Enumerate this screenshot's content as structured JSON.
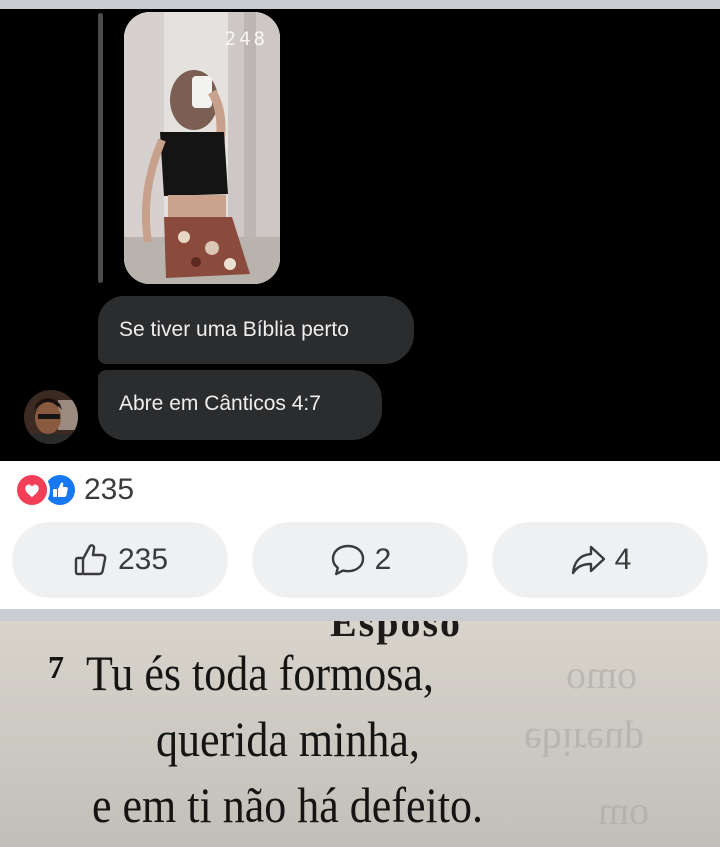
{
  "chat": {
    "story_view_count": "248",
    "messages": [
      "Se tiver uma Bíblia perto",
      "Abre em Cânticos 4:7"
    ]
  },
  "reactions": {
    "types": [
      "love-icon",
      "like-icon"
    ],
    "count": "235"
  },
  "actions": {
    "like_count": "235",
    "comment_count": "2",
    "share_count": "4"
  },
  "bible_page": {
    "heading_fragment": "Esposo",
    "verse_number": "7",
    "lines": [
      "Tu és toda formosa,",
      "querida minha,",
      "e em ti não há defeito."
    ]
  },
  "colors": {
    "chat_background": "#000000",
    "bubble": "#2b2c2e",
    "love_red": "#f33e58",
    "like_blue": "#1877f2",
    "button_bg": "#eff0f2",
    "separator": "#c9ccd1"
  }
}
